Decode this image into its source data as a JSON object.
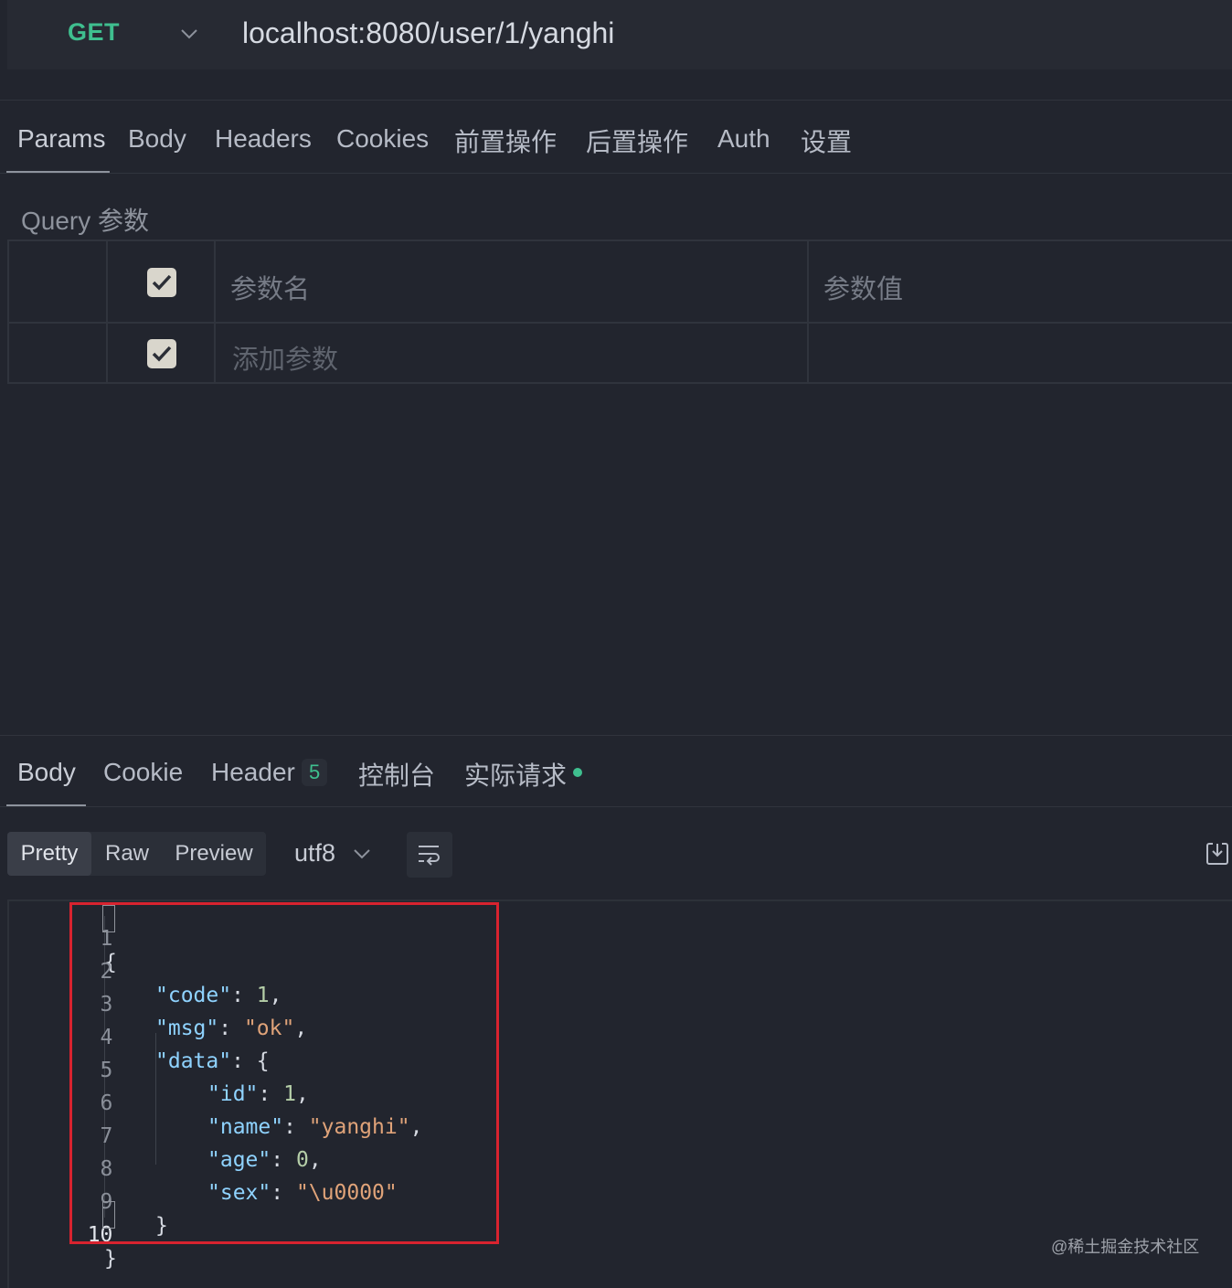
{
  "request": {
    "method": "GET",
    "url": "localhost:8080/user/1/yanghi"
  },
  "request_tabs": [
    {
      "label": "Params",
      "active": true
    },
    {
      "label": "Body"
    },
    {
      "label": "Headers"
    },
    {
      "label": "Cookies"
    },
    {
      "label": "前置操作"
    },
    {
      "label": "后置操作"
    },
    {
      "label": "Auth"
    },
    {
      "label": "设置"
    }
  ],
  "params": {
    "section_label": "Query 参数",
    "header": {
      "name": "参数名",
      "value": "参数值",
      "checked": true
    },
    "rows": [
      {
        "name_placeholder": "添加参数",
        "checked": true
      }
    ]
  },
  "response_tabs": [
    {
      "label": "Body",
      "active": true
    },
    {
      "label": "Cookie"
    },
    {
      "label": "Header",
      "badge": "5"
    },
    {
      "label": "控制台"
    },
    {
      "label": "实际请求",
      "indicator": true
    }
  ],
  "view_modes": [
    {
      "label": "Pretty",
      "active": true
    },
    {
      "label": "Raw"
    },
    {
      "label": "Preview"
    }
  ],
  "encoding": "utf8",
  "code_lines": [
    "1",
    "2",
    "3",
    "4",
    "5",
    "6",
    "7",
    "8",
    "9",
    "10"
  ],
  "code": {
    "open": "{",
    "code_key": "\"code\"",
    "code_val": "1",
    "msg_key": "\"msg\"",
    "msg_val": "\"ok\"",
    "data_key": "\"data\"",
    "id_key": "\"id\"",
    "id_val": "1",
    "name_key": "\"name\"",
    "name_val": "\"yanghi\"",
    "age_key": "\"age\"",
    "age_val": "0",
    "sex_key": "\"sex\"",
    "sex_val": "\"\\u0000\"",
    "inner_close": "}",
    "close": "}"
  },
  "watermark": "@稀土掘金技术社区",
  "colors": {
    "method": "#3fbf8f",
    "json_key": "#8fd3ff",
    "json_string": "#e0a379",
    "json_number": "#b5cea8",
    "highlight": "#d8232f"
  }
}
